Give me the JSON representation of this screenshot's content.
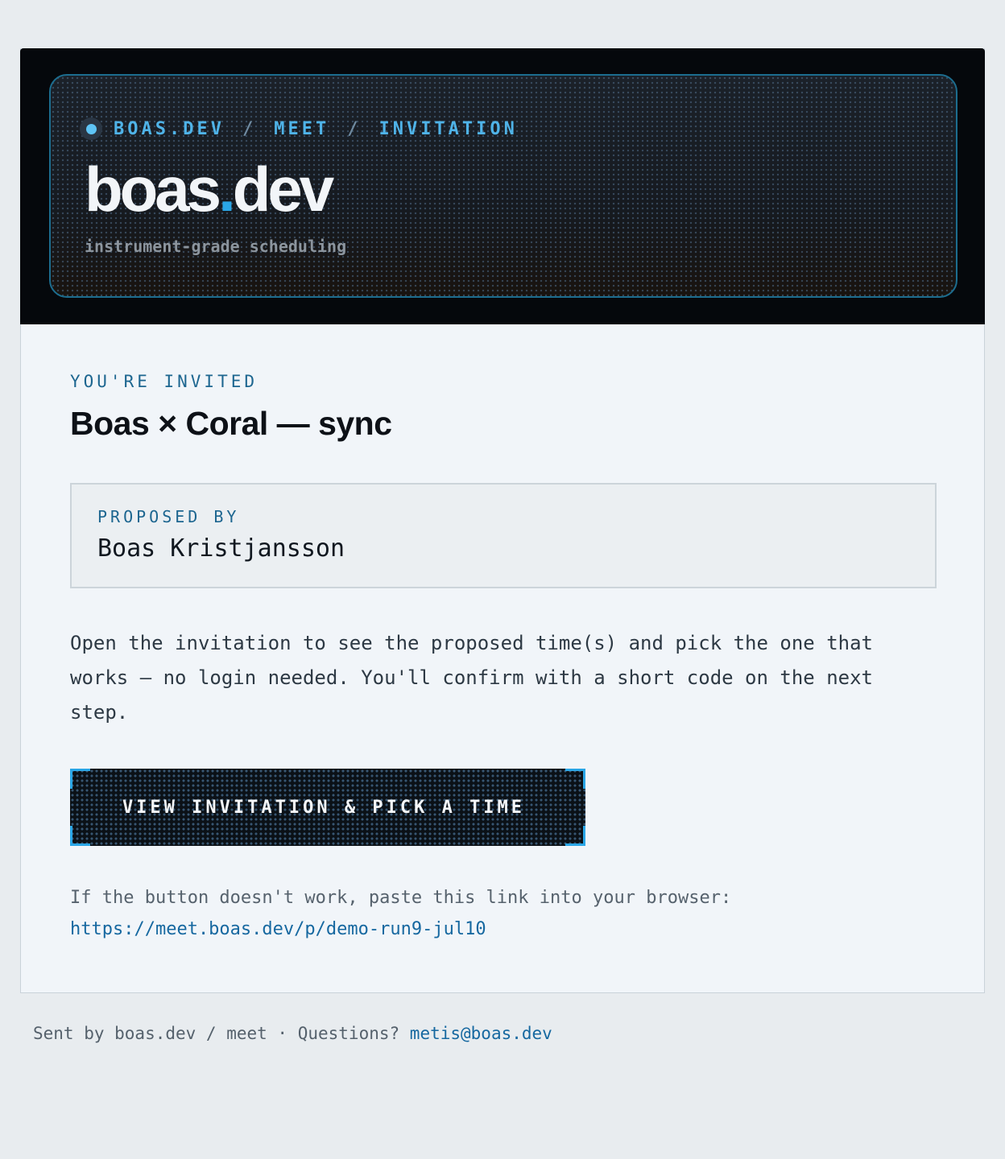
{
  "header": {
    "breadcrumb": [
      "BOAS.DEV",
      "MEET",
      "INVITATION"
    ],
    "breadcrumb_sep": "/",
    "brand_main": "boas",
    "brand_dot": ".",
    "brand_tld": "dev",
    "tagline": "instrument-grade scheduling"
  },
  "invite": {
    "eyebrow": "YOU'RE INVITED",
    "title": "Boas × Coral — sync",
    "proposed_by_label": "PROPOSED BY",
    "proposed_by_name": "Boas Kristjansson",
    "body": "Open the invitation to see the proposed time(s) and pick the one that works — no login needed. You'll confirm with a short code on the next step.",
    "cta_label": "VIEW INVITATION & PICK A TIME",
    "fallback_text": "If the button doesn't work, paste this link into your browser:",
    "fallback_url": "https://meet.boas.dev/p/demo-run9-jul10"
  },
  "footer": {
    "text": "Sent by boas.dev / meet · Questions? ",
    "email": "metis@boas.dev"
  },
  "colors": {
    "accent": "#2aa6e6",
    "eyebrow": "#1d6690",
    "link": "#1668a0",
    "header_bg": "#05080c",
    "page_bg": "#e8ecef"
  }
}
